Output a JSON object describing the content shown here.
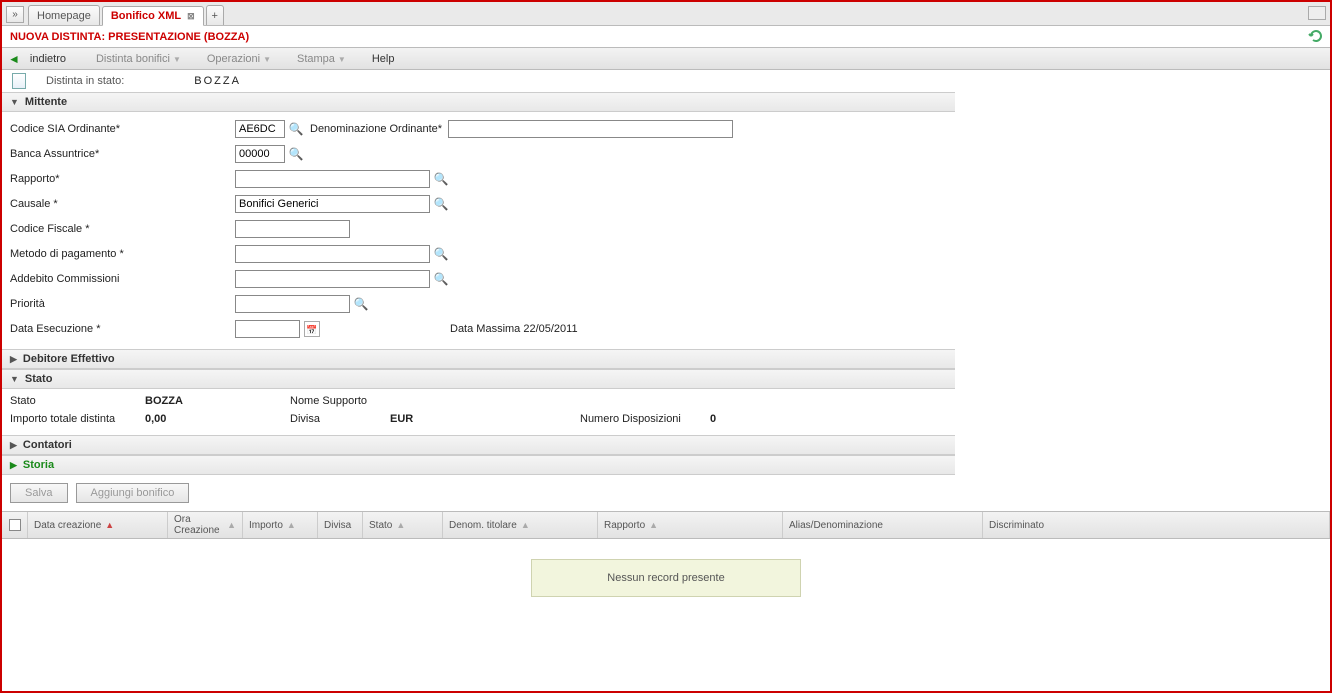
{
  "tabs": {
    "homepage": "Homepage",
    "active": "Bonifico XML"
  },
  "title": "NUOVA DISTINTA: PRESENTAZIONE (BOZZA)",
  "menu": {
    "back": "indietro",
    "distinta": "Distinta bonifici",
    "operazioni": "Operazioni",
    "stampa": "Stampa",
    "help": "Help"
  },
  "status_row": {
    "label": "Distinta in stato:",
    "value": "BOZZA"
  },
  "sections": {
    "mittente": "Mittente",
    "debitore": "Debitore Effettivo",
    "stato": "Stato",
    "contatori": "Contatori",
    "storia": "Storia"
  },
  "form": {
    "codice_sia_lbl": "Codice SIA Ordinante*",
    "codice_sia_val": "AE6DC",
    "denom_ord_lbl": "Denominazione Ordinante*",
    "denom_ord_val": "",
    "banca_lbl": "Banca Assuntrice*",
    "banca_val": "00000",
    "rapporto_lbl": "Rapporto*",
    "rapporto_val": "",
    "causale_lbl": "Causale *",
    "causale_val": "Bonifici Generici",
    "cf_lbl": "Codice Fiscale *",
    "cf_val": "",
    "metodo_lbl": "Metodo di pagamento *",
    "metodo_val": "",
    "addebito_lbl": "Addebito Commissioni",
    "addebito_val": "",
    "priorita_lbl": "Priorità",
    "priorita_val": "",
    "data_esec_lbl": "Data Esecuzione *",
    "data_esec_val": "",
    "data_max_lbl": "Data Massima 22/05/2011"
  },
  "stato": {
    "stato_lbl": "Stato",
    "stato_val": "BOZZA",
    "nome_supporto_lbl": "Nome Supporto",
    "nome_supporto_val": "",
    "importo_lbl": "Importo totale distinta",
    "importo_val": "0,00",
    "divisa_lbl": "Divisa",
    "divisa_val": "EUR",
    "numdisp_lbl": "Numero Disposizioni",
    "numdisp_val": "0"
  },
  "buttons": {
    "salva": "Salva",
    "aggiungi": "Aggiungi bonifico"
  },
  "columns": {
    "data_creazione": "Data creazione",
    "ora_creazione": "Ora Creazione",
    "importo": "Importo",
    "divisa": "Divisa",
    "stato": "Stato",
    "denom": "Denom. titolare",
    "rapporto": "Rapporto",
    "alias": "Alias/Denominazione",
    "discriminato": "Discriminato"
  },
  "empty": "Nessun record presente"
}
